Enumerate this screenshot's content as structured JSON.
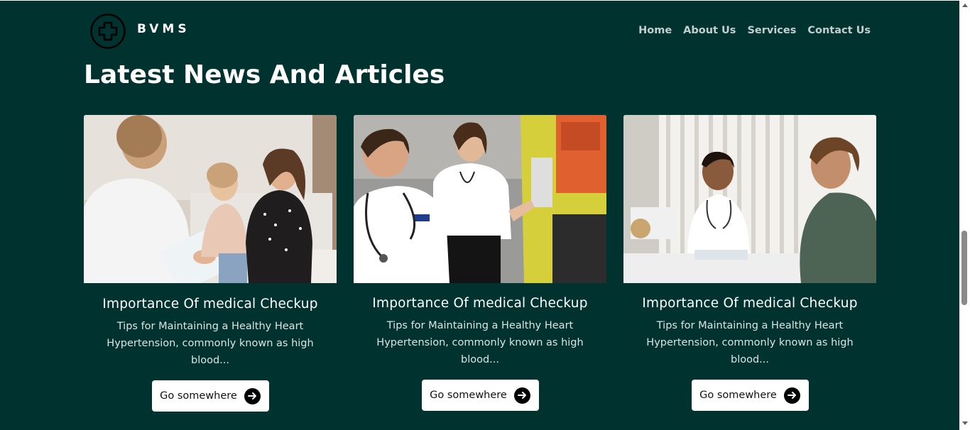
{
  "header": {
    "brand": "BVMS",
    "logo_icon": "medical-cross-icon",
    "nav": [
      {
        "label": "Home"
      },
      {
        "label": "About Us"
      },
      {
        "label": "Services"
      },
      {
        "label": "Contact Us"
      }
    ]
  },
  "section": {
    "title": "Latest News And Articles"
  },
  "cards": [
    {
      "image": "doctor-consulting-mother-and-daughter-photo",
      "title": "Importance Of medical Checkup",
      "text": "Tips for Maintaining a Healthy Heart Hypertension, commonly known as high blood...",
      "button_label": "Go somewhere",
      "button_icon": "arrow-right-circle-icon"
    },
    {
      "image": "paramedics-at-ambulance-photo",
      "title": "Importance Of medical Checkup",
      "text": "Tips for Maintaining a Healthy Heart Hypertension, commonly known as high blood...",
      "button_label": "Go somewhere",
      "button_icon": "arrow-right-circle-icon"
    },
    {
      "image": "doctor-with-patient-at-desk-photo",
      "title": "Importance Of medical Checkup",
      "text": "Tips for Maintaining a Healthy Heart Hypertension, commonly known as high blood...",
      "button_label": "Go somewhere",
      "button_icon": "arrow-right-circle-icon"
    }
  ],
  "colors": {
    "background": "#003330",
    "accent": "#ffffff",
    "nav_text": "#c4cfcd"
  }
}
